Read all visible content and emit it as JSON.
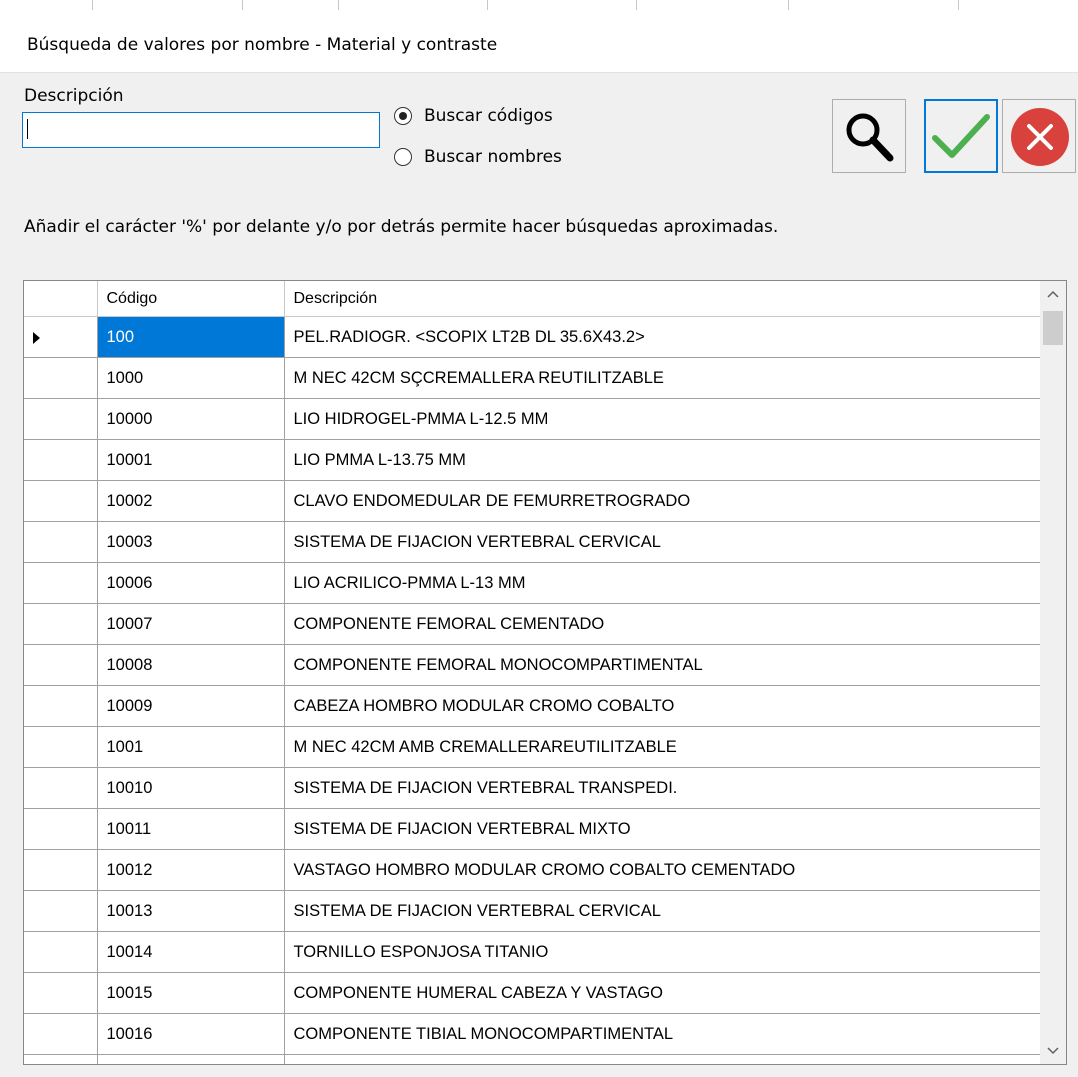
{
  "window": {
    "title": "Búsqueda de valores por nombre - Material y contraste"
  },
  "search": {
    "label": "Descripción",
    "value": "",
    "options": [
      {
        "label": "Buscar códigos",
        "checked": true
      },
      {
        "label": "Buscar nombres",
        "checked": false
      }
    ],
    "hint": "Añadir el carácter '%' por delante y/o por detrás permite hacer búsquedas aproximadas."
  },
  "buttons": {
    "search_icon": "magnifier-icon",
    "accept_icon": "checkmark-icon",
    "cancel_icon": "close-circle-icon",
    "accept_color": "#4caf50",
    "cancel_color": "#d9413d"
  },
  "grid": {
    "columns": [
      "Código",
      "Descripción"
    ],
    "rows": [
      {
        "code": "100",
        "description": "PEL.RADIOGR. <SCOPIX LT2B DL 35.6X43.2>",
        "selected": true
      },
      {
        "code": "1000",
        "description": "M NEC 42CM SÇCREMALLERA REUTILITZABLE"
      },
      {
        "code": "10000",
        "description": "LIO HIDROGEL-PMMA L-12.5 MM"
      },
      {
        "code": "10001",
        "description": "LIO PMMA L-13.75 MM"
      },
      {
        "code": "10002",
        "description": "CLAVO ENDOMEDULAR DE FEMURRETROGRADO"
      },
      {
        "code": "10003",
        "description": "SISTEMA DE FIJACION VERTEBRAL CERVICAL"
      },
      {
        "code": "10006",
        "description": "LIO ACRILICO-PMMA L-13 MM"
      },
      {
        "code": "10007",
        "description": "COMPONENTE FEMORAL CEMENTADO"
      },
      {
        "code": "10008",
        "description": "COMPONENTE FEMORAL MONOCOMPARTIMENTAL"
      },
      {
        "code": "10009",
        "description": "CABEZA HOMBRO MODULAR CROMO COBALTO"
      },
      {
        "code": "1001",
        "description": "M NEC 42CM AMB CREMALLERAREUTILITZABLE"
      },
      {
        "code": "10010",
        "description": "SISTEMA DE FIJACION VERTEBRAL TRANSPEDI."
      },
      {
        "code": "10011",
        "description": "SISTEMA DE FIJACION VERTEBRAL MIXTO"
      },
      {
        "code": "10012",
        "description": "VASTAGO HOMBRO MODULAR CROMO COBALTO CEMENTADO"
      },
      {
        "code": "10013",
        "description": "SISTEMA DE FIJACION VERTEBRAL CERVICAL"
      },
      {
        "code": "10014",
        "description": "TORNILLO ESPONJOSA TITANIO"
      },
      {
        "code": "10015",
        "description": "COMPONENTE HUMERAL CABEZA Y VASTAGO"
      },
      {
        "code": "10016",
        "description": "COMPONENTE TIBIAL MONOCOMPARTIMENTAL"
      },
      {
        "code": "",
        "description": ""
      }
    ]
  }
}
